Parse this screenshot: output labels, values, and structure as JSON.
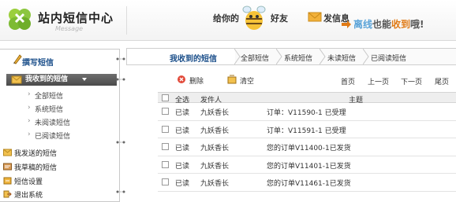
{
  "header": {
    "title": "站内短信中心",
    "subtitle": "Message",
    "give_prefix": "给你的",
    "give_suffix": "好友",
    "send_label": "发信息",
    "slogan_part1": "离线",
    "slogan_part2": "也能",
    "slogan_part3": "收到",
    "slogan_part4": "哦!"
  },
  "sidebar": {
    "compose_label": "撰写短信",
    "inbox_label": "我收到的短信",
    "sub_items": [
      "全部短信",
      "系统短信",
      "未阅读短信",
      "已阅读短信"
    ],
    "nav_items": [
      "我发送的短信",
      "我草稿的短信",
      "短信设置",
      "退出系统"
    ]
  },
  "main": {
    "active_tab": "我收到的短信",
    "crumbs": [
      "全部短信",
      "系统短信",
      "未读短信",
      "已阅读短信"
    ],
    "toolbar": {
      "delete_label": "删除",
      "clear_label": "清空",
      "first": "首页",
      "prev": "上一页",
      "next": "下一页",
      "last": "尾页"
    },
    "table": {
      "headers": {
        "select_all": "全选",
        "sender": "发件人",
        "subject": "主题"
      },
      "rows": [
        {
          "status": "已读",
          "sender": "九妖香长",
          "subject": "订单：V11590-1 已受理"
        },
        {
          "status": "已读",
          "sender": "九妖香长",
          "subject": "订单：V11591-1 已受理"
        },
        {
          "status": "已读",
          "sender": "九妖香长",
          "subject": "您的订单V11400-1已发货"
        },
        {
          "status": "已读",
          "sender": "九妖香长",
          "subject": "您的订单V11401-1已发货"
        },
        {
          "status": "已读",
          "sender": "九妖香长",
          "subject": "您的订单V11461-1已发货"
        }
      ]
    }
  },
  "colors": {
    "accent_blue": "#1b4f8a",
    "slogan_blue": "#5aa3d8",
    "slogan_orange": "#e07a15",
    "inbox_bg": "#4b4b4b"
  }
}
